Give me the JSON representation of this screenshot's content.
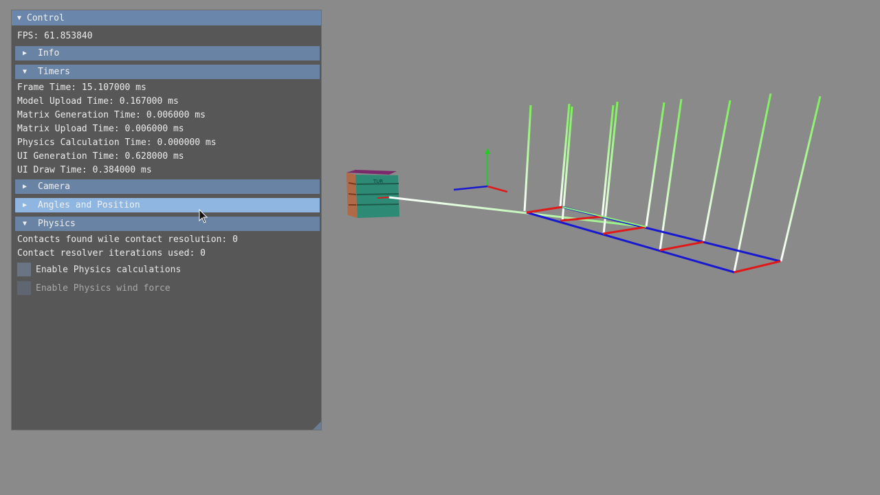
{
  "window": {
    "title": "Control",
    "fps_label": "FPS: 61.853840"
  },
  "sections": {
    "info": "Info",
    "timers": "Timers",
    "camera": "Camera",
    "angles": "Angles and Position",
    "physics": "Physics"
  },
  "timers": {
    "frame": "Frame Time: 15.107000 ms",
    "model_upload": "Model Upload Time: 0.167000 ms",
    "matrix_generation": "Matrix Generation Time: 0.006000 ms",
    "matrix_upload": "Matrix Upload Time: 0.006000 ms",
    "physics_calc": "Physics Calculation Time: 0.000000 ms",
    "ui_generation": "UI Generation Time: 0.628000 ms",
    "ui_draw": "UI Draw Time: 0.384000 ms"
  },
  "physics": {
    "contacts_found": "Contacts found wile contact resolution: 0",
    "resolver_iterations": "Contact resolver iterations used: 0",
    "enable_calc_label": "Enable Physics calculations",
    "enable_wind_label": "Enable Physics wind force",
    "enable_calc_checked": false,
    "enable_wind_checked": false
  },
  "crate_label": "TUR",
  "colors": {
    "background": "#8a8a8a",
    "panel": "#575757",
    "header": "#6983a5",
    "header_hover": "#8fb6e0",
    "axis_x": "#e01818",
    "axis_y": "#22cc22",
    "axis_z": "#1818d0",
    "spring_top": "#7cf05a",
    "spring_bottom": "#ffffff"
  }
}
